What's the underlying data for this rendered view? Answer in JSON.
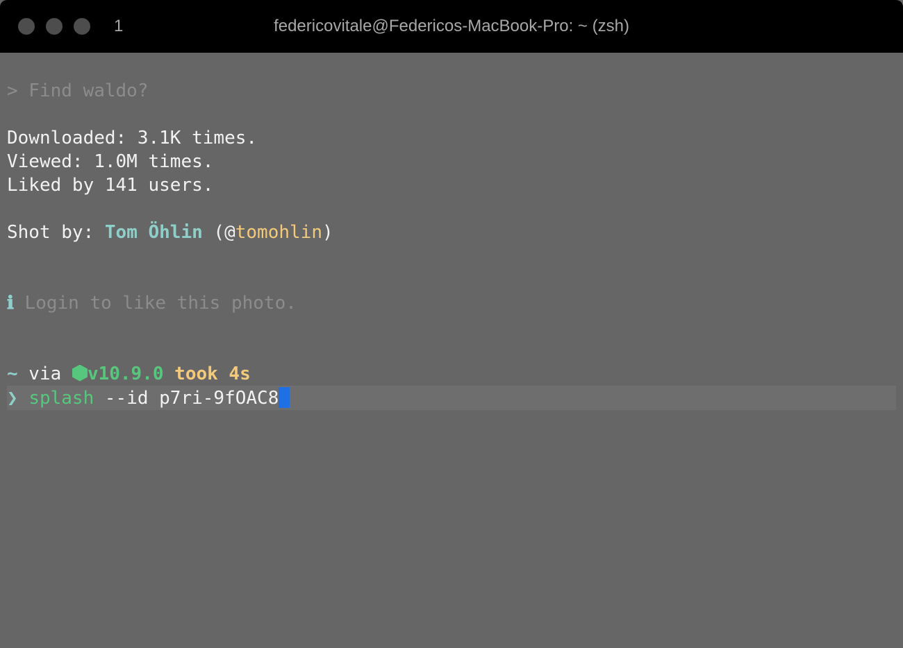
{
  "window": {
    "tab_index": "1",
    "title": "federicovitale@Federicos-MacBook-Pro: ~ (zsh)"
  },
  "colors": {
    "background": "#666666",
    "titlebar": "#000000",
    "cursor": "#1f6fe5",
    "accent_teal": "#8fcfc9",
    "accent_yellow": "#f3c97a",
    "accent_green": "#57c77d"
  },
  "output": {
    "query": "> Find waldo?",
    "downloaded": "Downloaded: 3.1K times.",
    "viewed": "Viewed: 1.0M times.",
    "liked": "Liked by 141 users.",
    "shot_by_label": "Shot by: ",
    "author_name": "Tom Öhlin",
    "handle_open": " (@",
    "author_handle": "tomohlin",
    "handle_close": ")",
    "info_icon": "ℹ",
    "info_message": " Login to like this photo."
  },
  "prompt": {
    "dir": "~",
    "via": " via ",
    "node_icon": "node-hexagon-icon",
    "node_version": "v10.9.0",
    "took": " took 4s",
    "symbol": "❯ ",
    "command": "splash",
    "args": " --id p7ri-9fOAC8"
  }
}
